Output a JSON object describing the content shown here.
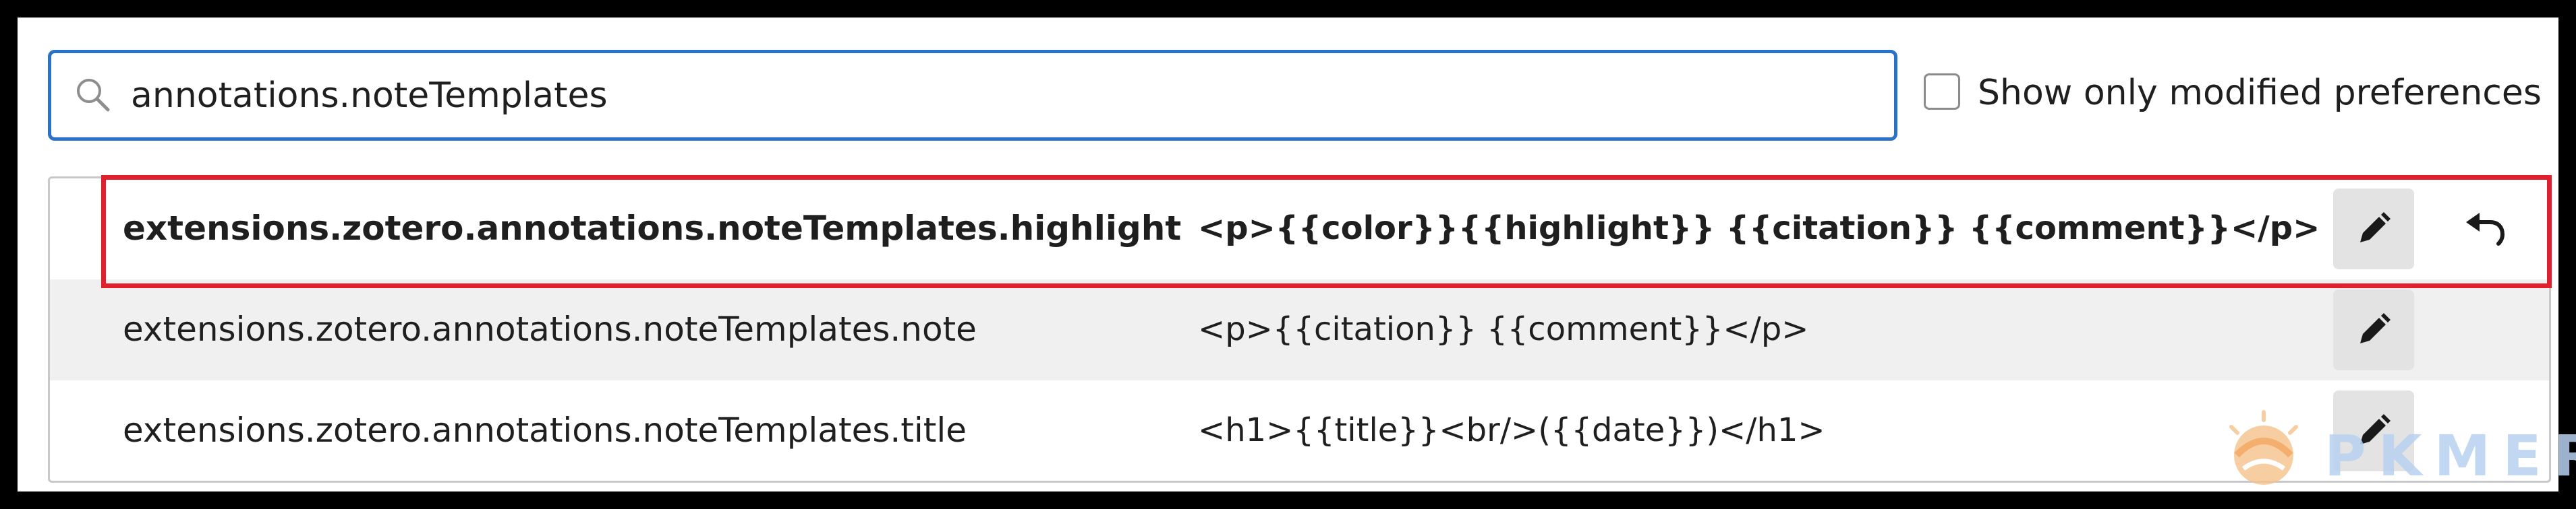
{
  "search": {
    "value": "annotations.noteTemplates"
  },
  "filter": {
    "show_modified_label": "Show only modified preferences",
    "show_modified_checked": false
  },
  "preferences": [
    {
      "name": "extensions.zotero.annotations.noteTemplates.highlight",
      "value": "<p>{{color}}{{highlight}} {{citation}} {{comment}}</p>",
      "modified": true
    },
    {
      "name": "extensions.zotero.annotations.noteTemplates.note",
      "value": "<p>{{citation}} {{comment}}</p>",
      "modified": false
    },
    {
      "name": "extensions.zotero.annotations.noteTemplates.title",
      "value": "<h1>{{title}}<br/>({{date}})</h1>",
      "modified": false
    }
  ],
  "icons": {
    "search": "search-icon",
    "edit": "pencil-icon",
    "reset": "undo-icon"
  },
  "colors": {
    "focus_border": "#2a72c7",
    "highlight_frame": "#e0202e",
    "row_alt_bg": "#f0f0f0",
    "button_bg": "#e3e3e3"
  },
  "watermark": {
    "text": "PKMER"
  }
}
